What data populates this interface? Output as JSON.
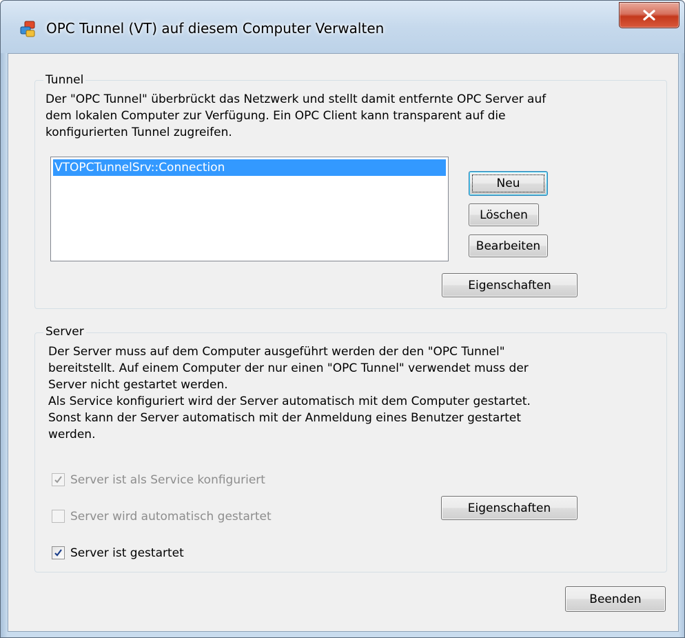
{
  "window": {
    "title": "OPC Tunnel (VT) auf diesem Computer Verwalten",
    "close_glyph": "X",
    "icon": "opc-app-icon"
  },
  "tunnel": {
    "group_label": "Tunnel",
    "description_lines": [
      "Der \"OPC Tunnel\" überbrückt das Netzwerk und stellt damit entfernte OPC Server auf",
      "dem lokalen Computer zur Verfügung. Ein OPC Client kann transparent auf die",
      "konfigurierten Tunnel zugreifen."
    ],
    "list_items": [
      "VTOPCTunnelSrv::Connection"
    ],
    "selected_item": "VTOPCTunnelSrv::Connection",
    "buttons": {
      "new": "Neu",
      "delete": "Löschen",
      "edit": "Bearbeiten",
      "properties": "Eigenschaften"
    }
  },
  "server": {
    "group_label": "Server",
    "description_lines": [
      "Der Server muss auf dem Computer ausgeführt werden der den \"OPC Tunnel\"",
      "bereitstellt. Auf einem Computer der nur einen \"OPC Tunnel\" verwendet muss der",
      "Server nicht gestartet werden.",
      "Als Service konfiguriert wird der Server automatisch mit dem Computer gestartet.",
      "Sonst kann der Server automatisch mit der Anmeldung eines Benutzer gestartet",
      "werden."
    ],
    "checkboxes": {
      "as_service": {
        "label": "Server ist als Service konfiguriert",
        "checked": true,
        "enabled": false
      },
      "autostart": {
        "label": "Server wird automatisch gestartet",
        "checked": false,
        "enabled": false
      },
      "started": {
        "label": "Server ist gestartet",
        "checked": true,
        "enabled": true
      }
    },
    "properties_button": "Eigenschaften"
  },
  "footer": {
    "exit_button": "Beenden"
  },
  "colors": {
    "selection": "#3399ff",
    "dialog_bg": "#f0f0f0",
    "close_button": "#c4391c",
    "disabled_text": "#8d8d8d"
  }
}
